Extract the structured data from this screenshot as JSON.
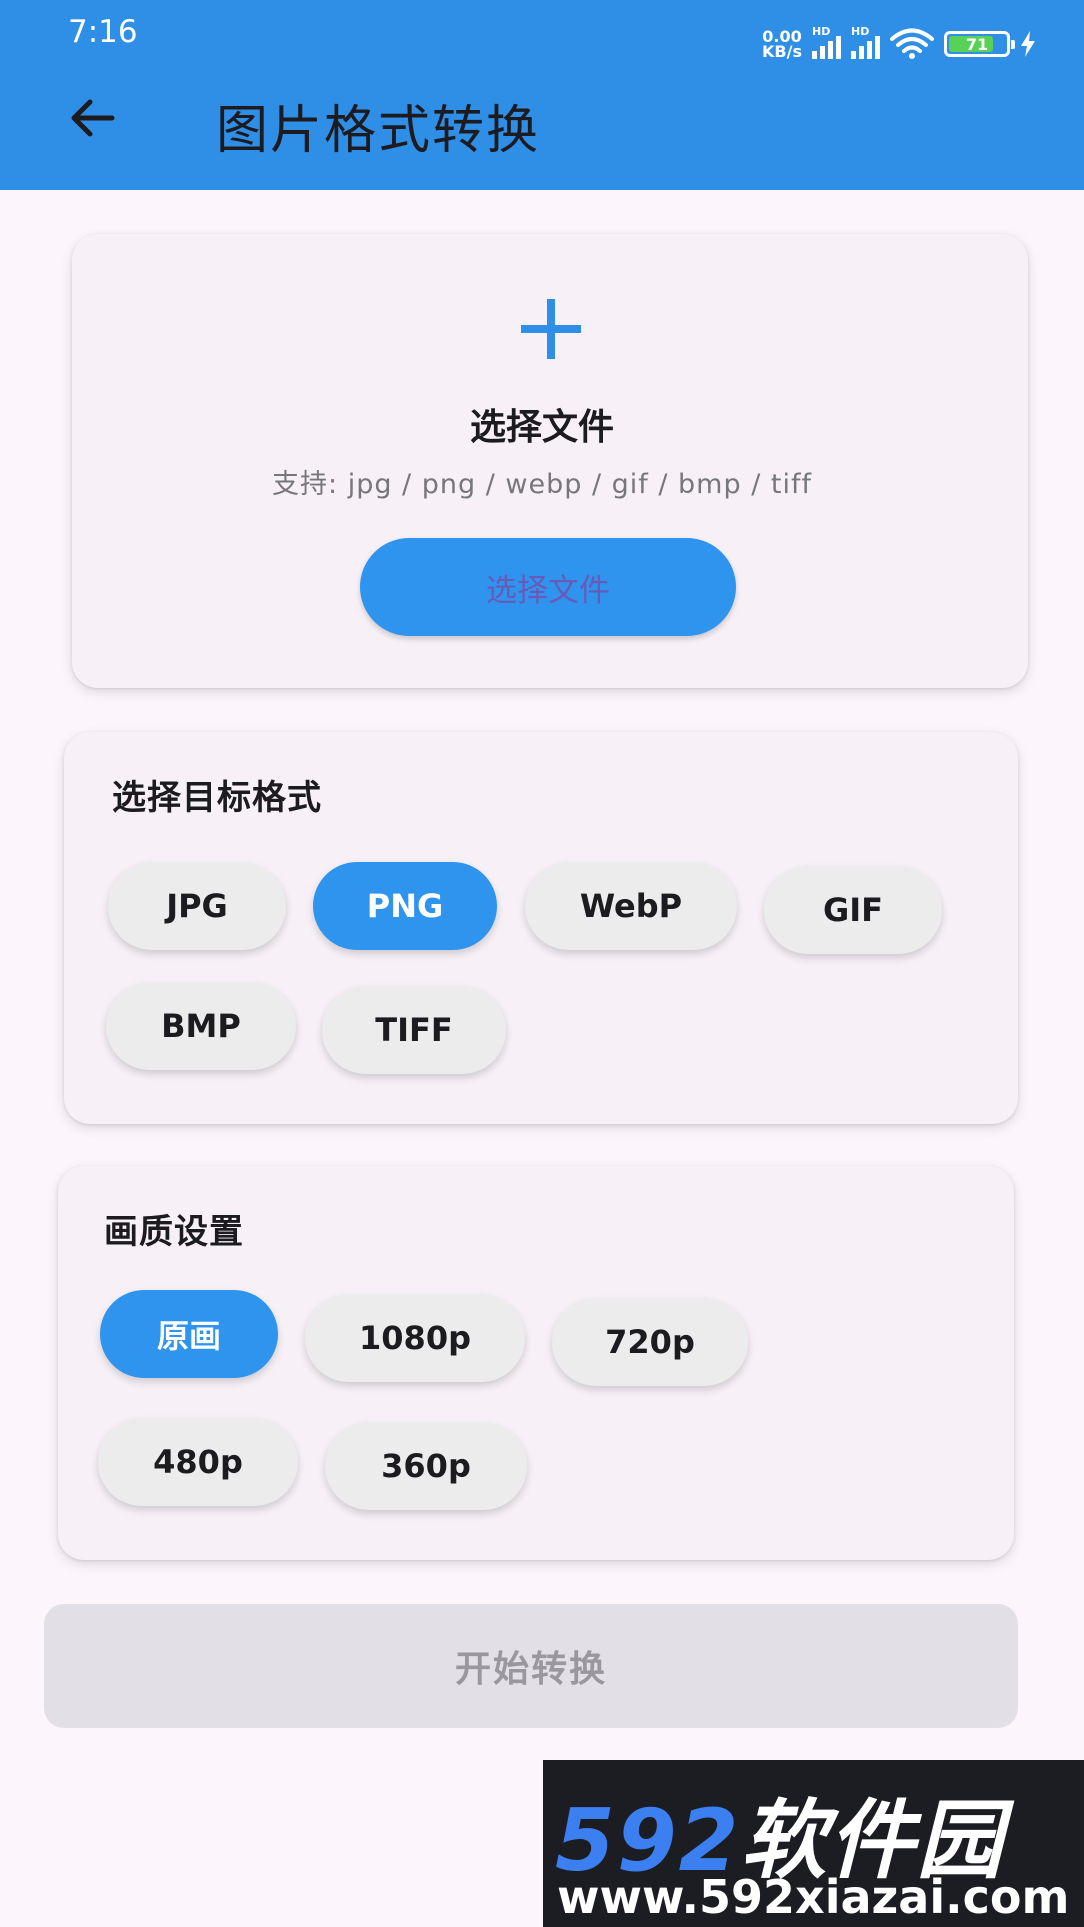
{
  "status_bar": {
    "time": "7:16",
    "net_speed_value": "0.00",
    "net_speed_unit": "KB/s",
    "signal_label": "HD",
    "battery": "71"
  },
  "header": {
    "title": "图片格式转换",
    "back_icon": "arrow-left-icon"
  },
  "file_picker": {
    "icon": "plus-icon",
    "title": "选择文件",
    "supported": "支持: jpg / png / webp / gif / bmp / tiff",
    "button_label": "选择文件"
  },
  "format_section": {
    "title": "选择目标格式",
    "options": [
      "JPG",
      "PNG",
      "WebP",
      "GIF",
      "BMP",
      "TIFF"
    ],
    "selected": "PNG"
  },
  "quality_section": {
    "title": "画质设置",
    "options": [
      "原画",
      "1080p",
      "720p",
      "480p",
      "360p"
    ],
    "selected": "原画"
  },
  "start_button": {
    "label": "开始转换"
  },
  "watermark": {
    "brand_number": "592",
    "brand_name": "软件园",
    "url": "www.592xiazai.com"
  },
  "colors": {
    "accent": "#2f8fe6",
    "background": "#fcf6fc",
    "chip": "#ececec"
  }
}
